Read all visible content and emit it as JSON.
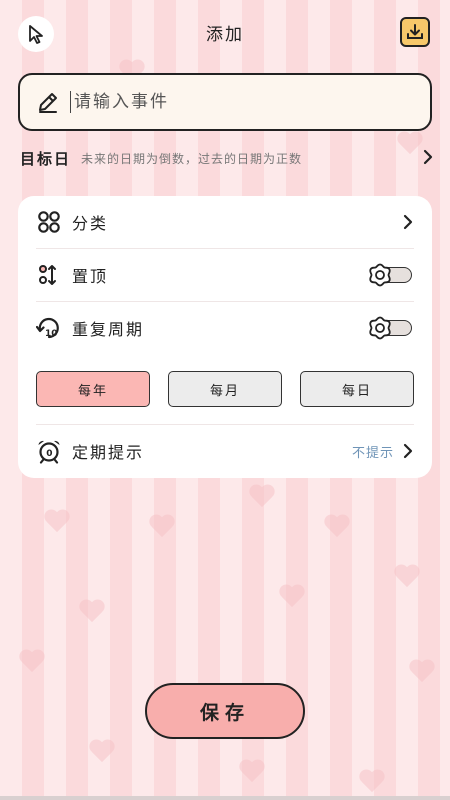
{
  "header": {
    "title": "添加"
  },
  "event": {
    "placeholder": "请输入事件"
  },
  "target_date": {
    "label": "目标日",
    "hint": "未来的日期为倒数，过去的日期为正数"
  },
  "settings": {
    "category": {
      "label": "分类"
    },
    "pin": {
      "label": "置顶",
      "enabled": false
    },
    "repeat": {
      "label": "重复周期",
      "enabled": false
    },
    "cycles": [
      {
        "label": "每年",
        "selected": true
      },
      {
        "label": "每月",
        "selected": false
      },
      {
        "label": "每日",
        "selected": false
      }
    ],
    "reminder": {
      "label": "定期提示",
      "value": "不提示"
    }
  },
  "save_label": "保存",
  "colors": {
    "accent": "#f8aeac",
    "reminder_text": "#6f94b7",
    "background": "#fde9ea"
  }
}
